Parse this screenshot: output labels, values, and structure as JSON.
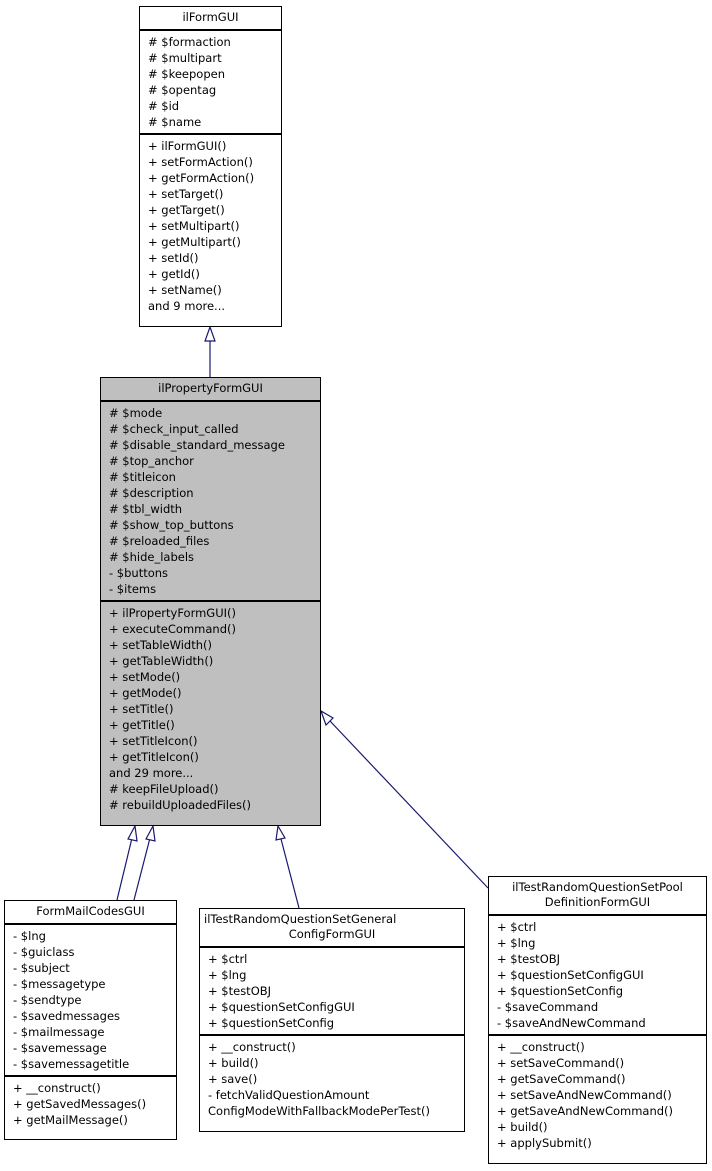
{
  "classes": {
    "ilFormGUI": {
      "name": "ilFormGUI",
      "attributes": [
        "# $formaction",
        "# $multipart",
        "# $keepopen",
        "# $opentag",
        "# $id",
        "# $name"
      ],
      "methods": [
        "+ ilFormGUI()",
        "+ setFormAction()",
        "+ getFormAction()",
        "+ setTarget()",
        "+ getTarget()",
        "+ setMultipart()",
        "+ getMultipart()",
        "+ setId()",
        "+ getId()",
        "+ setName()",
        "and 9 more..."
      ]
    },
    "ilPropertyFormGUI": {
      "name": "ilPropertyFormGUI",
      "highlighted": true,
      "attributes": [
        "# $mode",
        "# $check_input_called",
        "# $disable_standard_message",
        "# $top_anchor",
        "# $titleicon",
        "# $description",
        "# $tbl_width",
        "# $show_top_buttons",
        "# $reloaded_files",
        "# $hide_labels",
        "- $buttons",
        "- $items"
      ],
      "methods": [
        "+ ilPropertyFormGUI()",
        "+ executeCommand()",
        "+ setTableWidth()",
        "+ getTableWidth()",
        "+ setMode()",
        "+ getMode()",
        "+ setTitle()",
        "+ getTitle()",
        "+ setTitleIcon()",
        "+ getTitleIcon()",
        "and 29 more...",
        "# keepFileUpload()",
        "# rebuildUploadedFiles()"
      ]
    },
    "FormMailCodesGUI": {
      "name": "FormMailCodesGUI",
      "attributes": [
        "- $lng",
        "- $guiclass",
        "- $subject",
        "- $messagetype",
        "- $sendtype",
        "- $savedmessages",
        "- $mailmessage",
        "- $savemessage",
        "- $savemessagetitle"
      ],
      "methods": [
        "+ __construct()",
        "+ getSavedMessages()",
        "+ getMailMessage()"
      ]
    },
    "ilTestRandomQuestionSetGeneralConfigFormGUI": {
      "name_lines": [
        "ilTestRandomQuestionSetGeneral",
        "ConfigFormGUI"
      ],
      "attributes": [
        "+ $ctrl",
        "+ $lng",
        "+ $testOBJ",
        "+ $questionSetConfigGUI",
        "+ $questionSetConfig"
      ],
      "methods": [
        "+ __construct()",
        "+ build()",
        "+ save()",
        "- fetchValidQuestionAmount",
        "ConfigModeWithFallbackModePerTest()"
      ]
    },
    "ilTestRandomQuestionSetPoolDefinitionFormGUI": {
      "name_lines": [
        "ilTestRandomQuestionSetPool",
        "DefinitionFormGUI"
      ],
      "attributes": [
        "+ $ctrl",
        "+ $lng",
        "+ $testOBJ",
        "+ $questionSetConfigGUI",
        "+ $questionSetConfig",
        "- $saveCommand",
        "- $saveAndNewCommand"
      ],
      "methods": [
        "+ __construct()",
        "+ setSaveCommand()",
        "+ getSaveCommand()",
        "+ setSaveAndNewCommand()",
        "+ getSaveAndNewCommand()",
        "+ build()",
        "+ applySubmit()"
      ]
    }
  },
  "edges": [
    {
      "from": "ilPropertyFormGUI",
      "to": "ilFormGUI",
      "type": "inheritance"
    },
    {
      "from": "FormMailCodesGUI",
      "to": "ilPropertyFormGUI",
      "type": "inheritance"
    },
    {
      "from": "FormMailCodesGUI",
      "to": "ilPropertyFormGUI",
      "type": "inheritance"
    },
    {
      "from": "ilTestRandomQuestionSetGeneralConfigFormGUI",
      "to": "ilPropertyFormGUI",
      "type": "inheritance"
    },
    {
      "from": "ilTestRandomQuestionSetPoolDefinitionFormGUI",
      "to": "ilPropertyFormGUI",
      "type": "inheritance"
    }
  ],
  "colors": {
    "edge": "#191970",
    "highlight": "#bfbfbf",
    "border": "#000000"
  }
}
